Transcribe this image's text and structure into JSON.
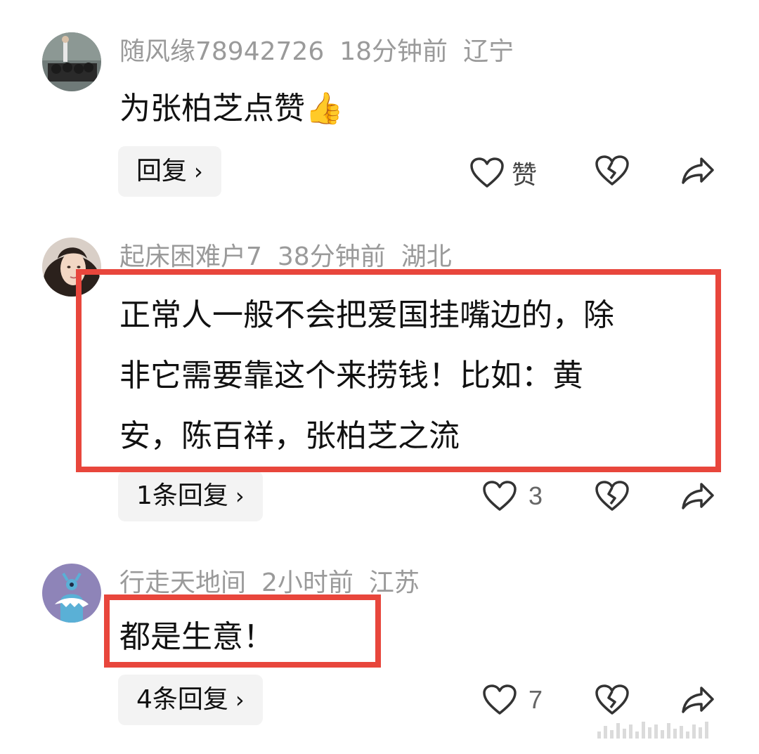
{
  "comments": [
    {
      "username": "随风缘78942726",
      "time": "18分钟前",
      "location": "辽宁",
      "content": "为张柏芝点赞👍",
      "reply_label": "回复",
      "like_label": "赞"
    },
    {
      "username": "起床困难户7",
      "time": "38分钟前",
      "location": "湖北",
      "content_lines": [
        "正常人一般不会把爱国挂嘴边的，除",
        "非它需要靠这个来捞钱！比如：黄",
        "安，陈百祥，张柏芝之流"
      ],
      "reply_label": "1条回复",
      "like_count": "3"
    },
    {
      "username": "行走天地间",
      "time": "2小时前",
      "location": "江苏",
      "content": "都是生意！",
      "reply_label": "4条回复",
      "like_count": "7"
    }
  ],
  "colors": {
    "highlight_border": "#e8463c",
    "meta_text": "#9a9a9a",
    "reply_bg": "#f3f3f3"
  },
  "icons": {
    "chevron": "›",
    "like": "heart-icon",
    "dislike": "broken-heart-icon",
    "share": "share-arrow-icon"
  }
}
